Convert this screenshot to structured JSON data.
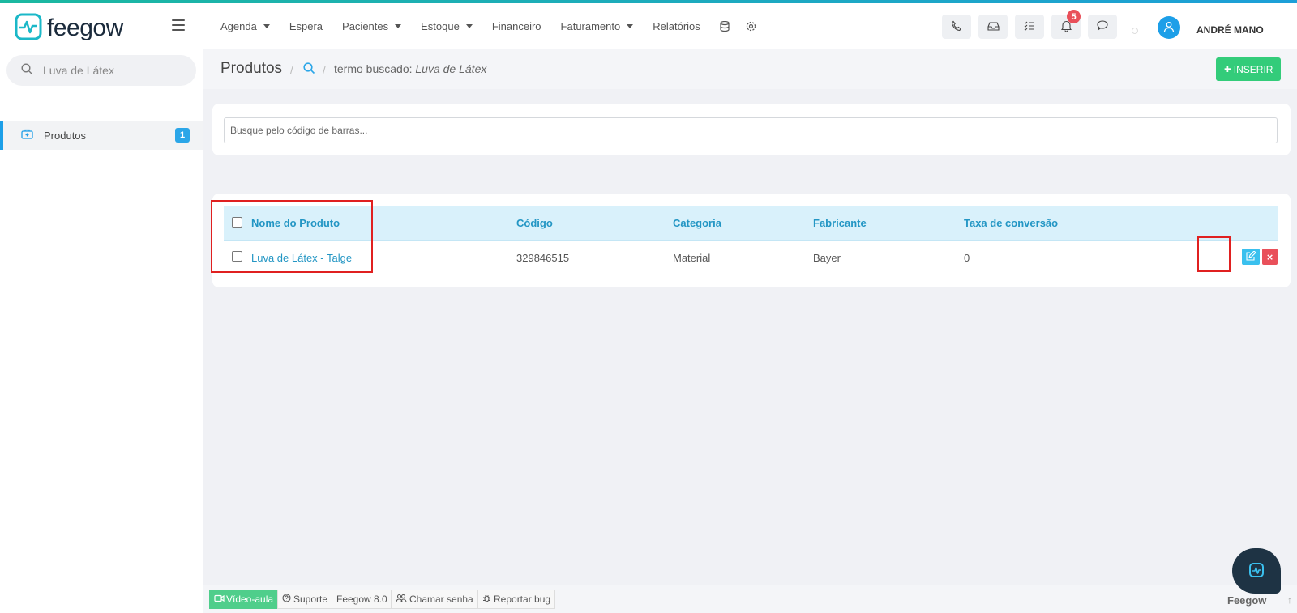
{
  "brand": {
    "name": "feegow"
  },
  "nav": {
    "items": [
      {
        "label": "Agenda",
        "dropdown": true
      },
      {
        "label": "Espera",
        "dropdown": false
      },
      {
        "label": "Pacientes",
        "dropdown": true
      },
      {
        "label": "Estoque",
        "dropdown": true
      },
      {
        "label": "Financeiro",
        "dropdown": false
      },
      {
        "label": "Faturamento",
        "dropdown": true
      },
      {
        "label": "Relatórios",
        "dropdown": false
      }
    ],
    "notification_count": "5",
    "user_name": "ANDRÉ MANO"
  },
  "sidebar": {
    "search_value": "Luva de Látex",
    "items": [
      {
        "label": "Produtos",
        "count": "1"
      }
    ]
  },
  "header": {
    "title": "Produtos",
    "term_prefix": "termo buscado:",
    "term": "Luva de Látex",
    "insert_label": "INSERIR"
  },
  "barcode": {
    "placeholder": "Busque pelo código de barras..."
  },
  "table": {
    "columns": [
      "Nome do Produto",
      "Código",
      "Categoria",
      "Fabricante",
      "Taxa de conversão"
    ],
    "rows": [
      {
        "name": "Luva de Látex - Talge",
        "code": "329846515",
        "category": "Material",
        "manufacturer": "Bayer",
        "rate": "0"
      }
    ]
  },
  "footer": {
    "video": "Vídeo-aula",
    "support": "Suporte",
    "version": "Feegow 8.0",
    "call": "Chamar senha",
    "bug": "Reportar bug",
    "brand": "Feegow"
  },
  "colors": {
    "accent": "#1d9fe8",
    "insert": "#33cc7a",
    "delete": "#e9505a",
    "highlight": "#e02020"
  }
}
